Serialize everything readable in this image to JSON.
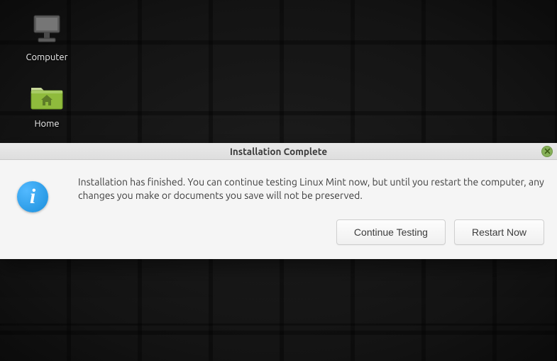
{
  "desktop": {
    "icons": [
      {
        "name": "computer",
        "label": "Computer"
      },
      {
        "name": "home",
        "label": "Home"
      }
    ]
  },
  "dialog": {
    "title": "Installation Complete",
    "icon": "info-icon",
    "close_name": "close-icon",
    "message": "Installation has finished.  You can continue testing Linux Mint now, but until you restart the computer, any changes you make or documents you save will not be preserved.",
    "buttons": {
      "continue_testing": "Continue Testing",
      "restart_now": "Restart Now"
    }
  },
  "colors": {
    "accent_green": "#87b159",
    "info_blue": "#1a8edb"
  }
}
